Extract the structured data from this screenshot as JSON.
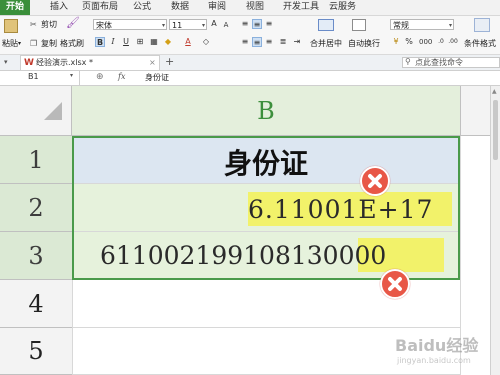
{
  "tabs": [
    "开始",
    "插入",
    "页面布局",
    "公式",
    "数据",
    "审阅",
    "视图",
    "开发工具",
    "云服务"
  ],
  "ribbon": {
    "cut": "剪切",
    "paste": "粘贴",
    "copy": "复制",
    "format_painter": "格式刷",
    "font_name": "宋体",
    "font_size": "11",
    "number_format": "常规",
    "merge_center": "合并居中",
    "wrap_text": "自动换行",
    "cond_format": "条件格式"
  },
  "doc": {
    "tab_title": "经验演示.xlsx *",
    "add_tab": "+",
    "search_placeholder": "点此查找命令"
  },
  "formula_bar": {
    "cell_ref": "B1",
    "fx": "fx",
    "content": "身份证"
  },
  "sheet": {
    "column_header": "B",
    "rows": [
      {
        "num": "1",
        "value": "身份证"
      },
      {
        "num": "2",
        "value": "6.11001E+17"
      },
      {
        "num": "3",
        "value_main": "611002199108130",
        "value_tail": "000"
      },
      {
        "num": "4",
        "value": ""
      },
      {
        "num": "5",
        "value": ""
      }
    ]
  },
  "watermark": {
    "line1": "Baidu经验",
    "line2": "jingyan.baidu.com"
  },
  "colors": {
    "accent_green": "#3a8f3a",
    "header_blue": "#dce6f1",
    "row_green": "#e6f2dc",
    "highlight_yellow": "#f2f26a",
    "error_red": "#e85747"
  }
}
